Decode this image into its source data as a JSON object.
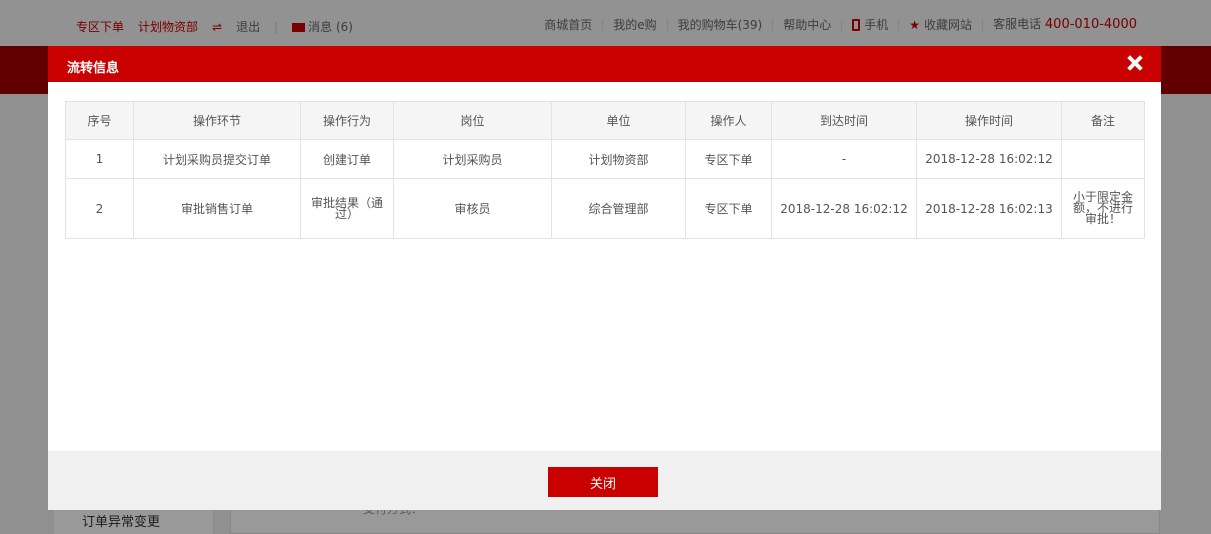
{
  "topbar": {
    "zone": "专区下单",
    "dept": "计划物资部",
    "switch_icon": "⇌",
    "logout": "退出",
    "messages": "消息 (6)",
    "links": [
      "商城首页",
      "我的e购",
      "我的购物车(39)",
      "帮助中心"
    ],
    "mobile": "手机",
    "favorite": "收藏网站",
    "hotline_label": "客服电话",
    "hotline": "400-010-4000"
  },
  "background": {
    "sidebar_item": "订单异常变更",
    "content_text": "支付方式："
  },
  "modal": {
    "title": "流转信息",
    "close_button": "关闭",
    "columns": [
      "序号",
      "操作环节",
      "操作行为",
      "岗位",
      "单位",
      "操作人",
      "到达时间",
      "操作时间",
      "备注"
    ],
    "rows": [
      [
        "1",
        "计划采购员提交订单",
        "创建订单",
        "计划采购员",
        "计划物资部",
        "专区下单",
        "-",
        "2018-12-28 16:02:12",
        ""
      ],
      [
        "2",
        "审批销售订单",
        "审批结果（通过）",
        "审核员",
        "综合管理部",
        "专区下单",
        "2018-12-28 16:02:12",
        "2018-12-28 16:02:13",
        "小于限定金额，不进行审批！"
      ]
    ]
  },
  "colors": {
    "brand_red": "#c80000",
    "header_band": "#a00000"
  }
}
